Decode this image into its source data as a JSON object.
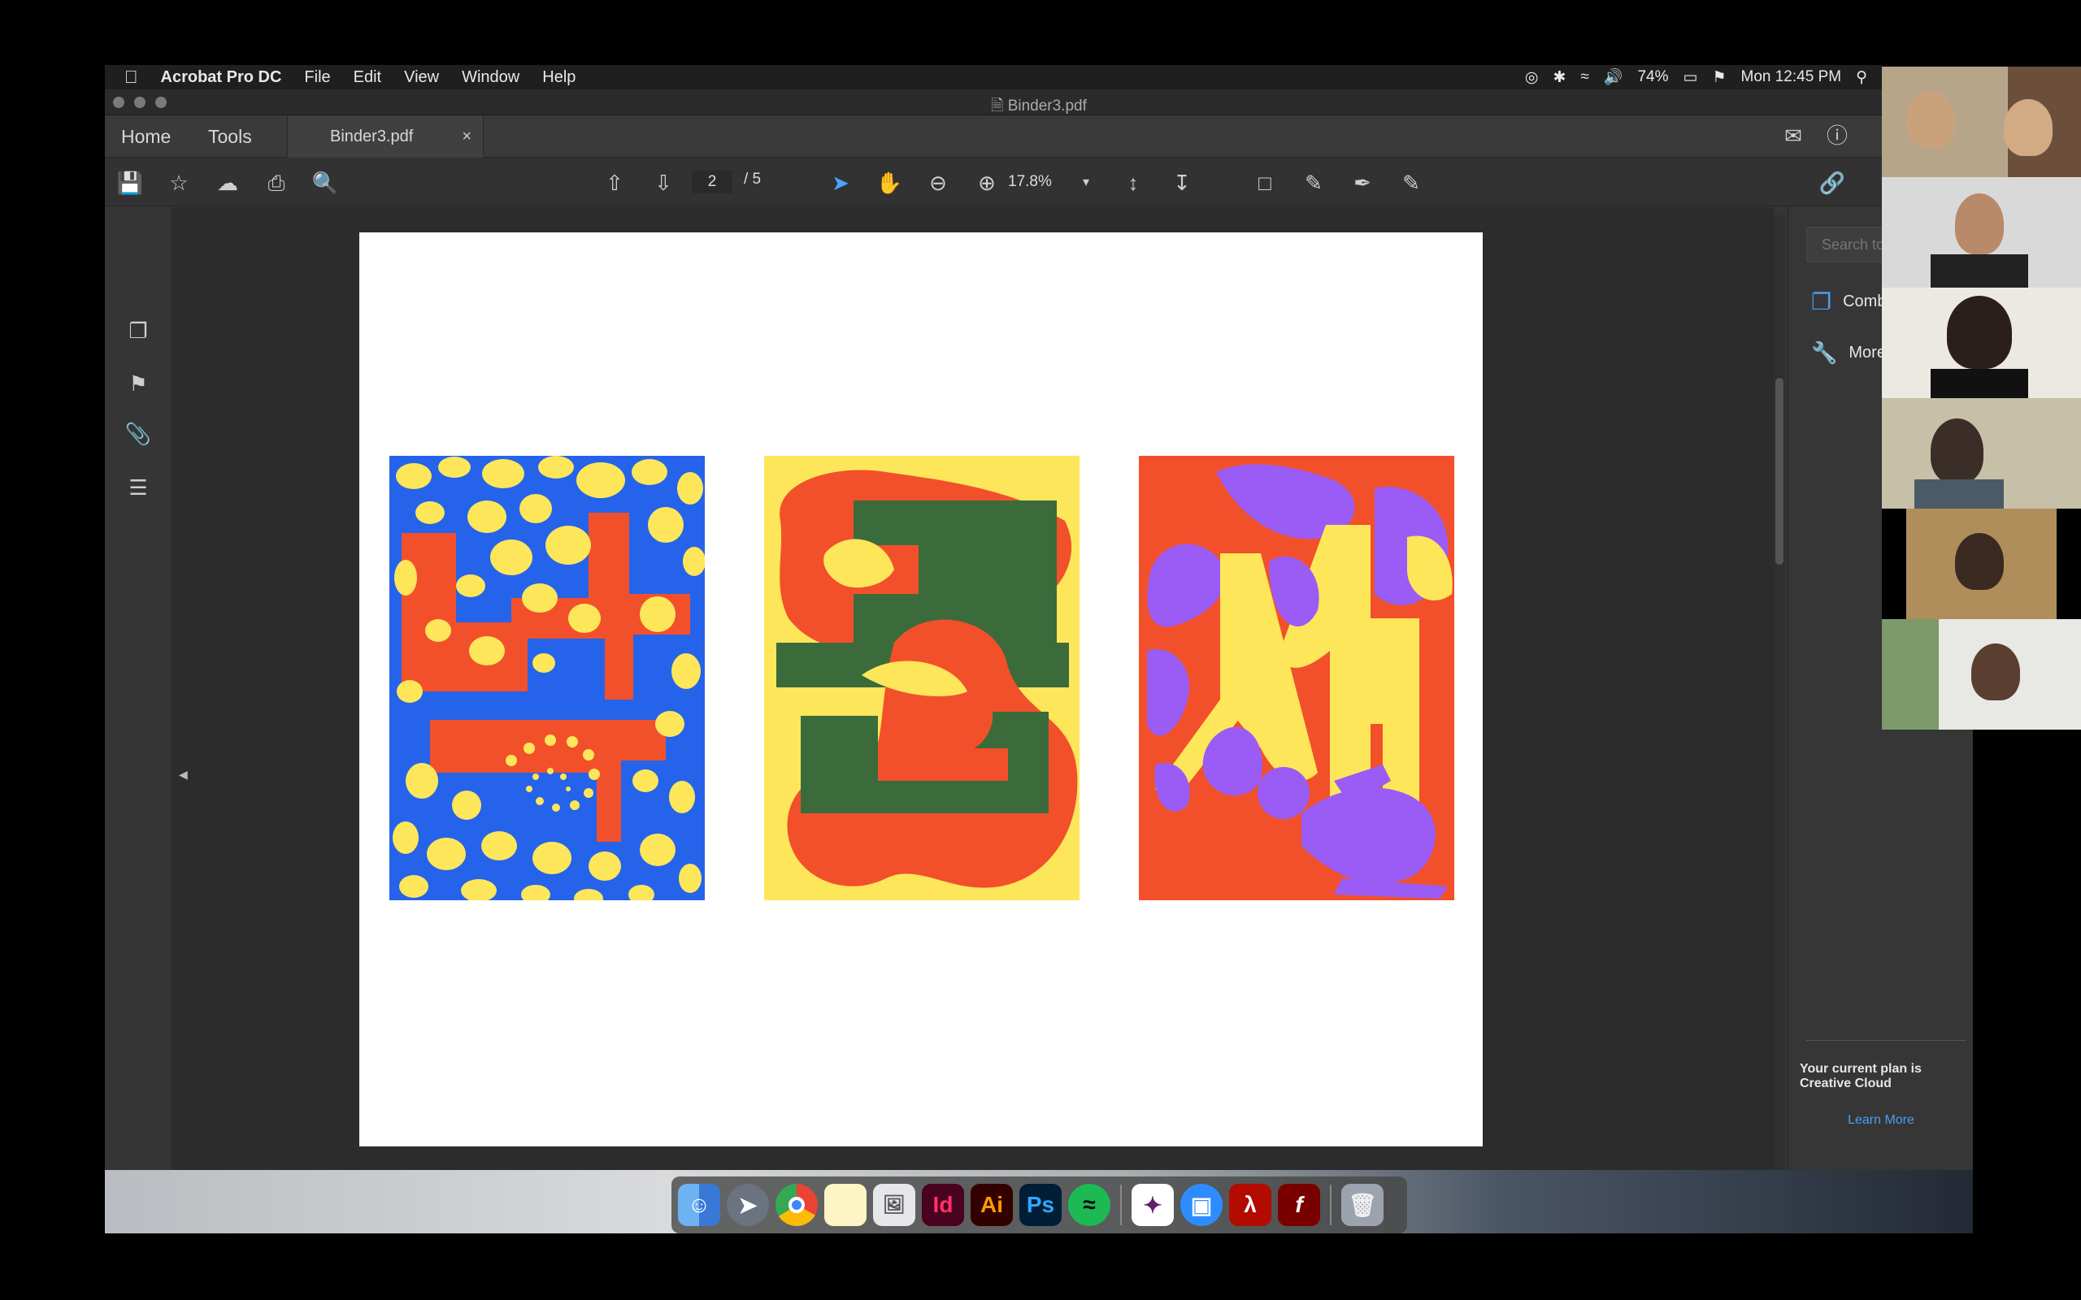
{
  "menubar": {
    "app_name": "Acrobat Pro DC",
    "items": [
      "File",
      "Edit",
      "View",
      "Window",
      "Help"
    ],
    "battery": "74%",
    "clock": "Mon 12:45 PM"
  },
  "window": {
    "title": "Binder3.pdf",
    "tabs": {
      "home": "Home",
      "tools": "Tools",
      "doc": "Binder3.pdf",
      "close": "×"
    }
  },
  "toolbar": {
    "current_page": "2",
    "page_total": "/ 5",
    "zoom": "17.8%"
  },
  "right_pane": {
    "search_placeholder": "Search tools",
    "items": [
      "Combine Files",
      "More Tools"
    ],
    "plan_text": "Your current plan is Creative Cloud",
    "learn_more": "Learn More"
  },
  "dock": {
    "icons": [
      "finder-icon",
      "launchpad-icon",
      "chrome-icon",
      "notes-icon",
      "preview-icon",
      "indesign-icon",
      "illustrator-icon",
      "photoshop-icon",
      "spotify-icon",
      "slack-icon",
      "zoom-icon",
      "acrobat-icon",
      "flash-icon",
      "trash-icon"
    ],
    "labels": {
      "indesign": "Id",
      "illustrator": "Ai",
      "photoshop": "Ps"
    }
  },
  "colors": {
    "blue": "#2563eb",
    "yellow": "#fde65a",
    "red": "#f2502a",
    "green": "#3b6b3a",
    "purple": "#9a5cf5"
  }
}
